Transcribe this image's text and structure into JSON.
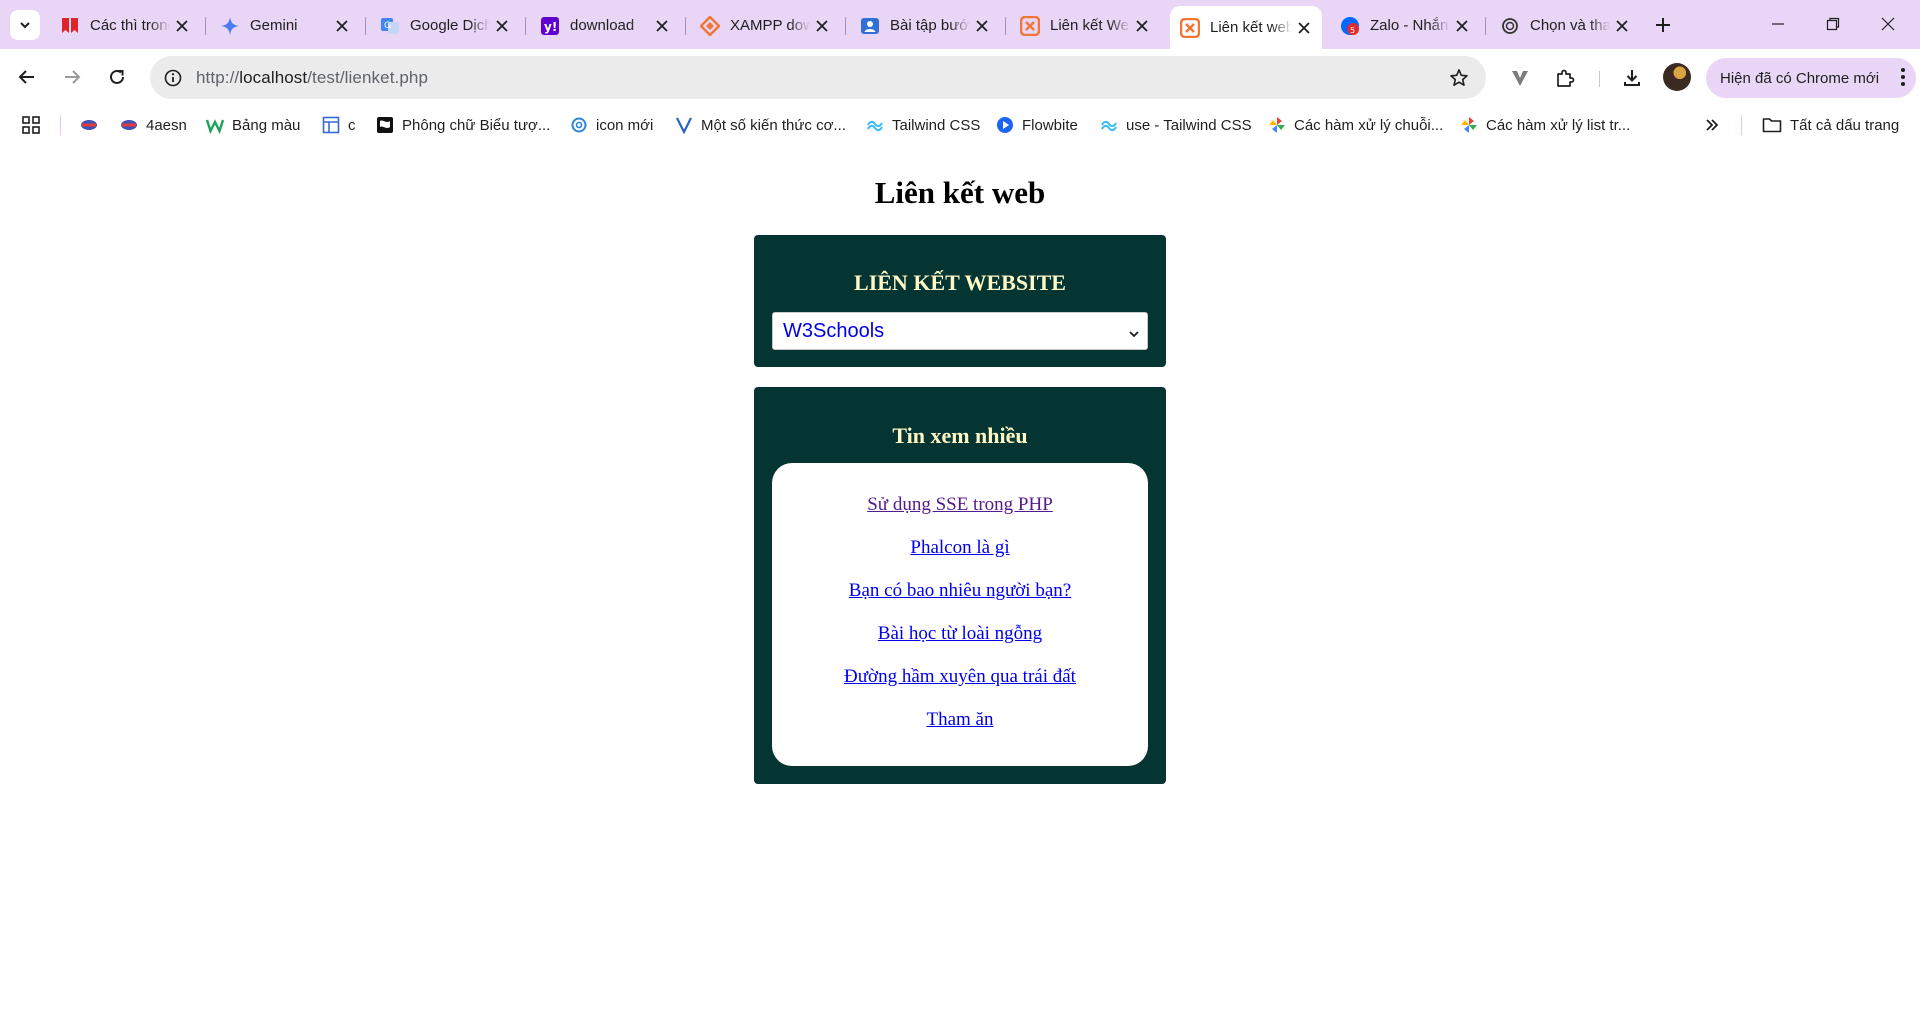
{
  "browser": {
    "tabs": [
      {
        "title": "Các thì trong",
        "favicon": "red-book-icon"
      },
      {
        "title": "Gemini",
        "favicon": "gemini-sparkle-icon"
      },
      {
        "title": "Google Dịch",
        "favicon": "google-translate-icon"
      },
      {
        "title": "download",
        "favicon": "yahoo-icon"
      },
      {
        "title": "XAMPP download",
        "favicon": "xampp-diamond-icon"
      },
      {
        "title": "Bài tập bước",
        "favicon": "contact-card-icon"
      },
      {
        "title": "Liên kết Web",
        "favicon": "xampp-icon"
      },
      {
        "title": "Liên kết web",
        "favicon": "xampp-icon",
        "active": true
      },
      {
        "title": "Zalo - Nhắn",
        "favicon": "zalo-icon"
      },
      {
        "title": "Chọn và thay",
        "favicon": "chatgpt-icon"
      }
    ],
    "url_prefix": "http://",
    "url_host": "localhost",
    "url_path": "/test/lienket.php",
    "chrome_banner": "Hiện đã có Chrome mới",
    "bookmarks": [
      {
        "label": "",
        "icon": "flag-bookmark-icon"
      },
      {
        "label": "4aesn",
        "icon": "flag-bookmark-icon"
      },
      {
        "label": "Bảng màu",
        "icon": "w-logo-icon"
      },
      {
        "label": "c",
        "icon": "layout-icon"
      },
      {
        "label": "Phông chữ Biểu tượ...",
        "icon": "font-icon"
      },
      {
        "label": "icon mới",
        "icon": "spiral-icon"
      },
      {
        "label": "Một số kiến thức cơ...",
        "icon": "v-logo-icon"
      },
      {
        "label": "Tailwind CSS",
        "icon": "tailwind-icon"
      },
      {
        "label": "Flowbite",
        "icon": "flowbite-icon"
      },
      {
        "label": "use - Tailwind CSS",
        "icon": "tailwind-icon"
      },
      {
        "label": "Các hàm xử lý chuỗi...",
        "icon": "pinwheel-icon"
      },
      {
        "label": "Các hàm xử lý list tr...",
        "icon": "pinwheel-icon"
      }
    ],
    "all_bookmarks": "Tất cả dấu trang"
  },
  "page": {
    "title": "Liên kết web",
    "website_box": {
      "heading": "LIÊN KẾT WEBSITE",
      "selected": "W3Schools"
    },
    "popular_box": {
      "heading": "Tin xem nhiều",
      "links": [
        "Sử dụng SSE trong PHP",
        "Phalcon là gì",
        "Bạn có bao nhiêu người bạn?",
        "Bài học từ loài ngỗng",
        "Đường hầm xuyên qua trái đất",
        "Tham ăn"
      ]
    }
  },
  "colors": {
    "tabstrip": "#e9d5f5",
    "panel": "#043532",
    "panel_heading": "#fff8c6",
    "link": "#0000ee",
    "visited_link": "#551a8b"
  }
}
